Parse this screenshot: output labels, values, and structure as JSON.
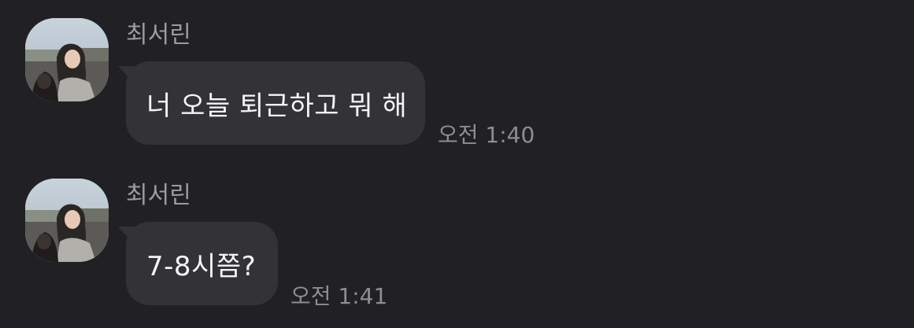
{
  "chat": {
    "messages": [
      {
        "sender": "최서린",
        "text": "너 오늘 퇴근하고 뭐 해",
        "time": "오전 1:40",
        "avatar_icon": "profile-photo"
      },
      {
        "sender": "최서린",
        "text": "7-8시쯤?",
        "time": "오전 1:41",
        "avatar_icon": "profile-photo"
      }
    ]
  },
  "colors": {
    "background": "#212024",
    "bubble": "#333237",
    "bubble_text": "#f4f4f6",
    "sender_name": "#9c9ba0",
    "timestamp": "#8e8d92"
  }
}
